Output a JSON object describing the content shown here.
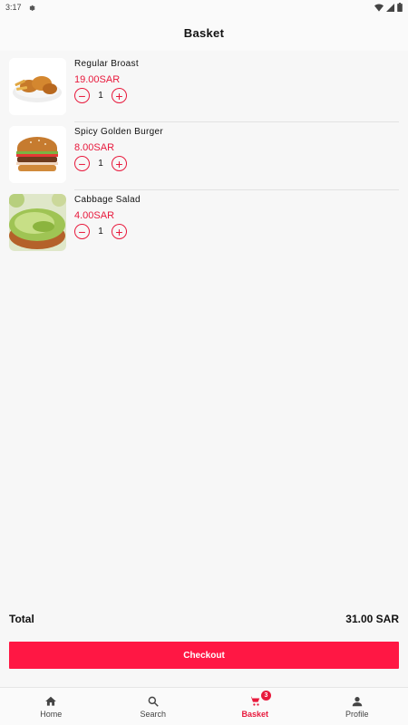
{
  "status_bar": {
    "time": "3:17"
  },
  "header": {
    "title": "Basket"
  },
  "items": [
    {
      "name": "Regular Broast",
      "price": "19.00SAR",
      "qty": "1",
      "image": "fried-chicken-image"
    },
    {
      "name": "Spicy Golden Burger",
      "price": "8.00SAR",
      "qty": "1",
      "image": "burger-image"
    },
    {
      "name": "Cabbage Salad",
      "price": "4.00SAR",
      "qty": "1",
      "image": "salad-image"
    }
  ],
  "controls": {
    "minus": "−",
    "plus": "+"
  },
  "total": {
    "label": "Total",
    "value": "31.00 SAR"
  },
  "checkout_label": "Checkout",
  "nav": {
    "home": "Home",
    "search": "Search",
    "basket": "Basket",
    "basket_badge": "3",
    "profile": "Profile"
  },
  "colors": {
    "accent": "#e8193c",
    "button": "#ff1744"
  }
}
